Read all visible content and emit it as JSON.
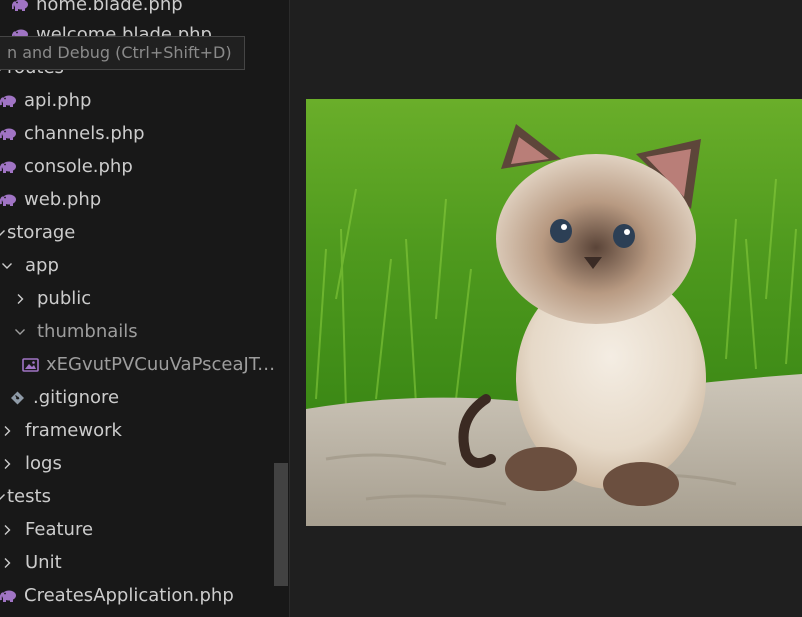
{
  "tooltip": {
    "text": "n and Debug (Ctrl+Shift+D)"
  },
  "tree": [
    {
      "label": "home.blade.php",
      "icon": "php-elephant-icon",
      "chevron": ""
    },
    {
      "label": "welcome.blade.php",
      "icon": "php-elephant-icon",
      "chevron": ""
    },
    {
      "label": "routes",
      "icon": "",
      "chevron": "expanded"
    },
    {
      "label": "api.php",
      "icon": "php-elephant-icon",
      "chevron": ""
    },
    {
      "label": "channels.php",
      "icon": "php-elephant-icon",
      "chevron": ""
    },
    {
      "label": "console.php",
      "icon": "php-elephant-icon",
      "chevron": ""
    },
    {
      "label": "web.php",
      "icon": "php-elephant-icon",
      "chevron": ""
    },
    {
      "label": "storage",
      "icon": "",
      "chevron": "expanded"
    },
    {
      "label": "app",
      "icon": "",
      "chevron": "expanded"
    },
    {
      "label": "public",
      "icon": "",
      "chevron": "collapsed"
    },
    {
      "label": "thumbnails",
      "icon": "",
      "chevron": "expanded"
    },
    {
      "label": "xEGvutPVCuuVaPsceaJTru...",
      "icon": "image-file-icon",
      "chevron": ""
    },
    {
      "label": ".gitignore",
      "icon": "git-diamond-icon",
      "chevron": ""
    },
    {
      "label": "framework",
      "icon": "",
      "chevron": "collapsed"
    },
    {
      "label": "logs",
      "icon": "",
      "chevron": "collapsed"
    },
    {
      "label": "tests",
      "icon": "",
      "chevron": "expanded"
    },
    {
      "label": "Feature",
      "icon": "",
      "chevron": "collapsed"
    },
    {
      "label": "Unit",
      "icon": "",
      "chevron": "collapsed"
    },
    {
      "label": "CreatesApplication.php",
      "icon": "php-elephant-icon",
      "chevron": ""
    }
  ],
  "preview": {
    "subject": "kitten-photo"
  },
  "colors": {
    "sidebar_bg": "#181818",
    "editor_bg": "#1f1f1f",
    "text": "#cccccc",
    "php_icon": "#a074c4",
    "image_icon": "#a074c4",
    "git_icon": "#8f9ba8"
  }
}
